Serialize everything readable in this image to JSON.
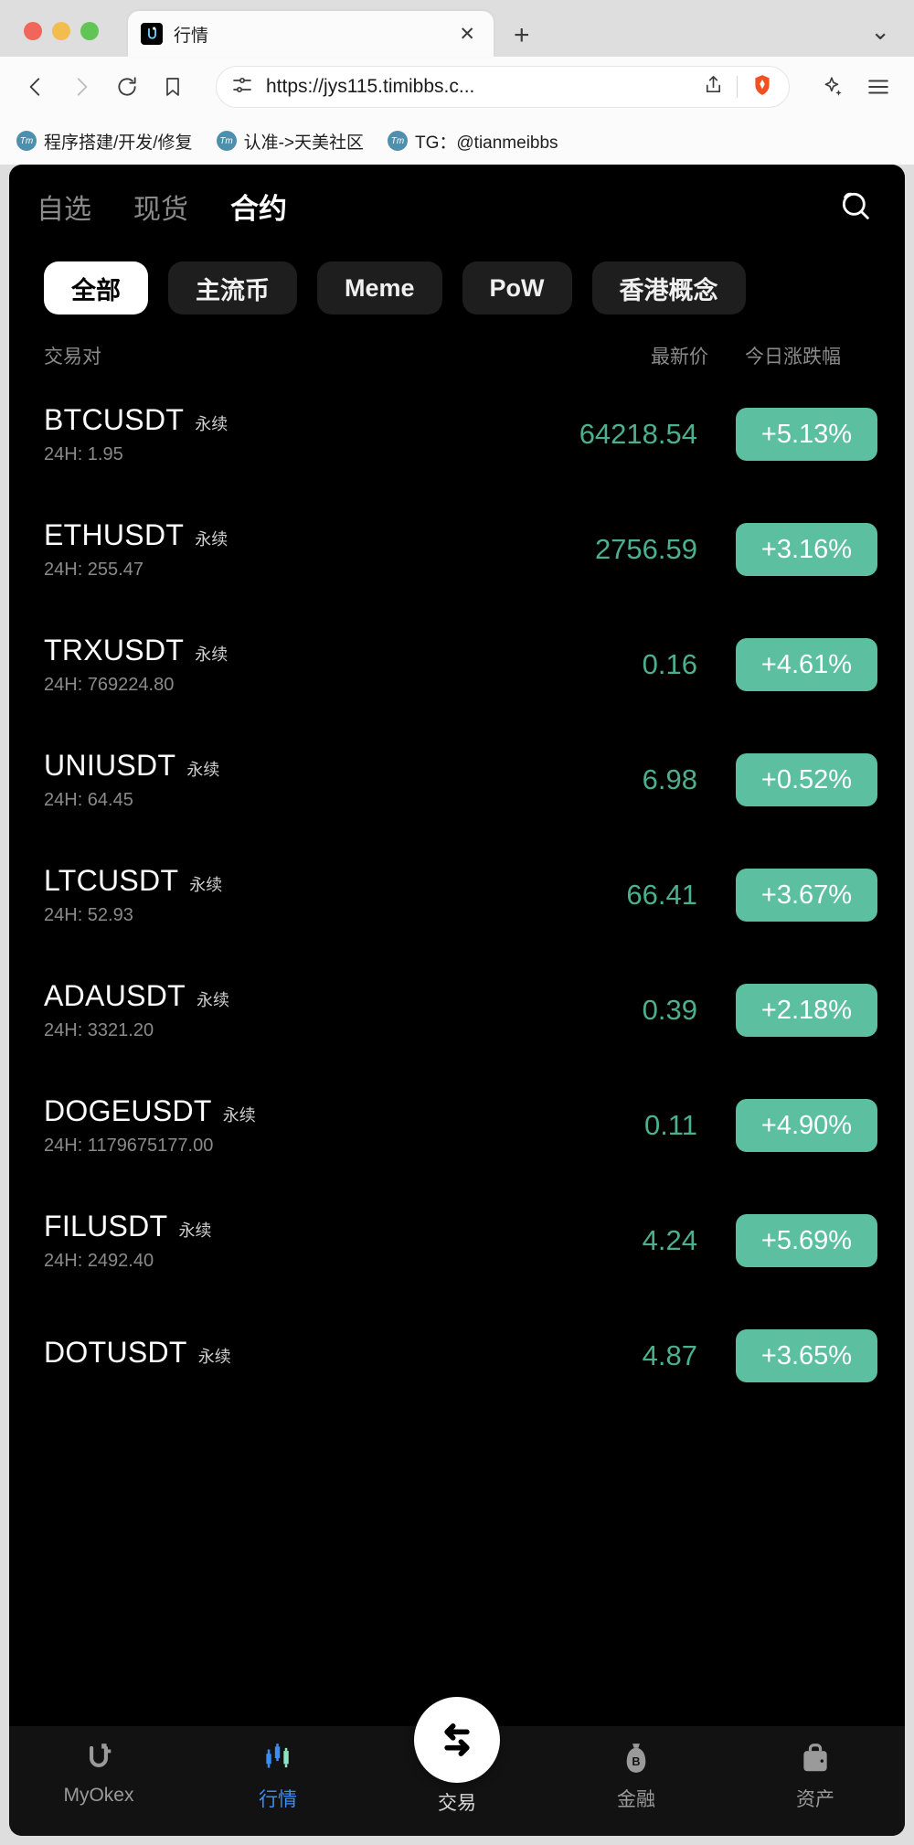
{
  "browser": {
    "tab": {
      "title": "行情",
      "close_label": "✕",
      "favicon_name": "okex-logo-icon"
    },
    "new_tab_label": "+",
    "tab_list_label": "⌄",
    "url": "https://jys115.timibbs.c...",
    "bookmarks": [
      {
        "label": "程序搭建/开发/修复",
        "icon": "Tm"
      },
      {
        "label": "认准->天美社区",
        "icon": "Tm"
      },
      {
        "label": "TG：@tianmeibbs",
        "icon": "Tm"
      }
    ]
  },
  "app": {
    "tabs": [
      {
        "label": "自选",
        "active": false
      },
      {
        "label": "现货",
        "active": false
      },
      {
        "label": "合约",
        "active": true
      }
    ],
    "chips": [
      {
        "label": "全部",
        "active": true
      },
      {
        "label": "主流币",
        "active": false
      },
      {
        "label": "Meme",
        "active": false
      },
      {
        "label": "PoW",
        "active": false
      },
      {
        "label": "香港概念",
        "active": false
      }
    ],
    "columns": {
      "pair": "交易对",
      "price": "最新价",
      "change": "今日涨跌幅"
    },
    "vol_prefix": "24H: ",
    "perpetual_tag": "永续",
    "colors": {
      "price_green": "#4caf8e",
      "badge_green": "#5cbfa0",
      "active_blue": "#3b8ef0",
      "background": "#000000"
    },
    "rows": [
      {
        "symbol": "BTCUSDT",
        "tag": "永续",
        "volume": "24H: 1.95",
        "price": "64218.54",
        "change": "+5.13%"
      },
      {
        "symbol": "ETHUSDT",
        "tag": "永续",
        "volume": "24H: 255.47",
        "price": "2756.59",
        "change": "+3.16%"
      },
      {
        "symbol": "TRXUSDT",
        "tag": "永续",
        "volume": "24H: 769224.80",
        "price": "0.16",
        "change": "+4.61%"
      },
      {
        "symbol": "UNIUSDT",
        "tag": "永续",
        "volume": "24H: 64.45",
        "price": "6.98",
        "change": "+0.52%"
      },
      {
        "symbol": "LTCUSDT",
        "tag": "永续",
        "volume": "24H: 52.93",
        "price": "66.41",
        "change": "+3.67%"
      },
      {
        "symbol": "ADAUSDT",
        "tag": "永续",
        "volume": "24H: 3321.20",
        "price": "0.39",
        "change": "+2.18%"
      },
      {
        "symbol": "DOGEUSDT",
        "tag": "永续",
        "volume": "24H: 1179675177.00",
        "price": "0.11",
        "change": "+4.90%"
      },
      {
        "symbol": "FILUSDT",
        "tag": "永续",
        "volume": "24H: 2492.40",
        "price": "4.24",
        "change": "+5.69%"
      },
      {
        "symbol": "DOTUSDT",
        "tag": "永续",
        "volume": "",
        "price": "4.87",
        "change": "+3.65%"
      }
    ],
    "tabbar": [
      {
        "label": "MyOkex",
        "icon": "okex-logo-icon",
        "active": false
      },
      {
        "label": "行情",
        "icon": "candlestick-icon",
        "active": true
      },
      {
        "label": "交易",
        "icon": "swap-arrows-icon",
        "active": false
      },
      {
        "label": "金融",
        "icon": "money-bag-icon",
        "active": false
      },
      {
        "label": "资产",
        "icon": "briefcase-icon",
        "active": false
      }
    ]
  }
}
